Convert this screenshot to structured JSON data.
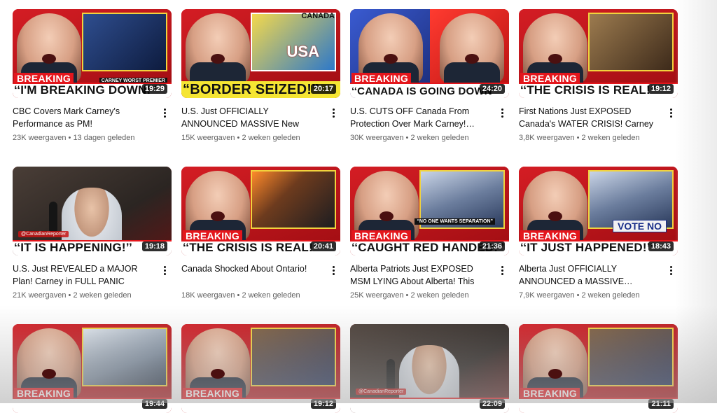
{
  "videos": [
    {
      "title": "CBC Covers Mark Carney's Performance as PM!",
      "views": "23K weergaven",
      "age": "13 dagen geleden",
      "duration": "19:29",
      "caption": "‘‘I'M BREAKING DOWN!’’",
      "breaking": "BREAKING",
      "overlay": "CARNEY WORST PREMIER"
    },
    {
      "title": "U.S. Just OFFICIALLY ANNOUNCED MASSIVE New Border Rules!…",
      "views": "15K weergaven",
      "age": "2 weken geleden",
      "duration": "20:17",
      "caption": "“BORDER SEIZED!”",
      "overlay_top": "CANADA",
      "overlay_big": "USA"
    },
    {
      "title": "U.S. CUTS OFF Canada From Protection Over Mark Carney!…",
      "views": "30K weergaven",
      "age": "2 weken geleden",
      "duration": "24:20",
      "caption": "‘‘CANADA IS GOING DOWN’’",
      "breaking": "BREAKING"
    },
    {
      "title": "First Nations Just EXPOSED Canada's WATER CRISIS! Carney in…",
      "views": "3,8K weergaven",
      "age": "2 weken geleden",
      "duration": "19:12",
      "caption": "‘‘THE CRISIS IS REAL!’’",
      "breaking": "BREAKING"
    },
    {
      "title": "U.S. Just REVEALED a MAJOR Plan! Carney in FULL PANIC MODE!",
      "views": "21K weergaven",
      "age": "2 weken geleden",
      "duration": "19:18",
      "caption": "‘‘IT IS HAPPENING!’’",
      "channel": "@CanadianReporter"
    },
    {
      "title": "Canada Shocked About Ontario!",
      "views": "18K weergaven",
      "age": "2 weken geleden",
      "duration": "20:41",
      "caption": "‘‘THE CRISIS IS REAL!’’",
      "breaking": "BREAKING"
    },
    {
      "title": "Alberta Patriots Just EXPOSED MSM LYING About Alberta! This is…",
      "views": "25K weergaven",
      "age": "2 weken geleden",
      "duration": "21:36",
      "caption": "‘‘CAUGHT RED HANDED!’’",
      "breaking": "BREAKING",
      "overlay": "“NO ONE WANTS SEPARATION”"
    },
    {
      "title": "Alberta Just OFFICIALLY ANNOUNCED a MASSIVE…",
      "views": "7,9K weergaven",
      "age": "2 weken geleden",
      "duration": "18:43",
      "caption": "‘‘IT JUST HAPPENED!’’",
      "breaking": "BREAKING",
      "overlay": "VOTE NO"
    },
    {
      "title": "",
      "views": "",
      "age": "",
      "duration": "19:44",
      "caption": "",
      "breaking": "BREAKING"
    },
    {
      "title": "",
      "views": "",
      "age": "",
      "duration": "19:12",
      "caption": "",
      "breaking": "BREAKING"
    },
    {
      "title": "",
      "views": "",
      "age": "",
      "duration": "22:09",
      "caption": "",
      "channel": "@CanadianReporter"
    },
    {
      "title": "",
      "views": "",
      "age": "",
      "duration": "21:11",
      "caption": "",
      "breaking": "BREAKING"
    }
  ],
  "separator": "•"
}
